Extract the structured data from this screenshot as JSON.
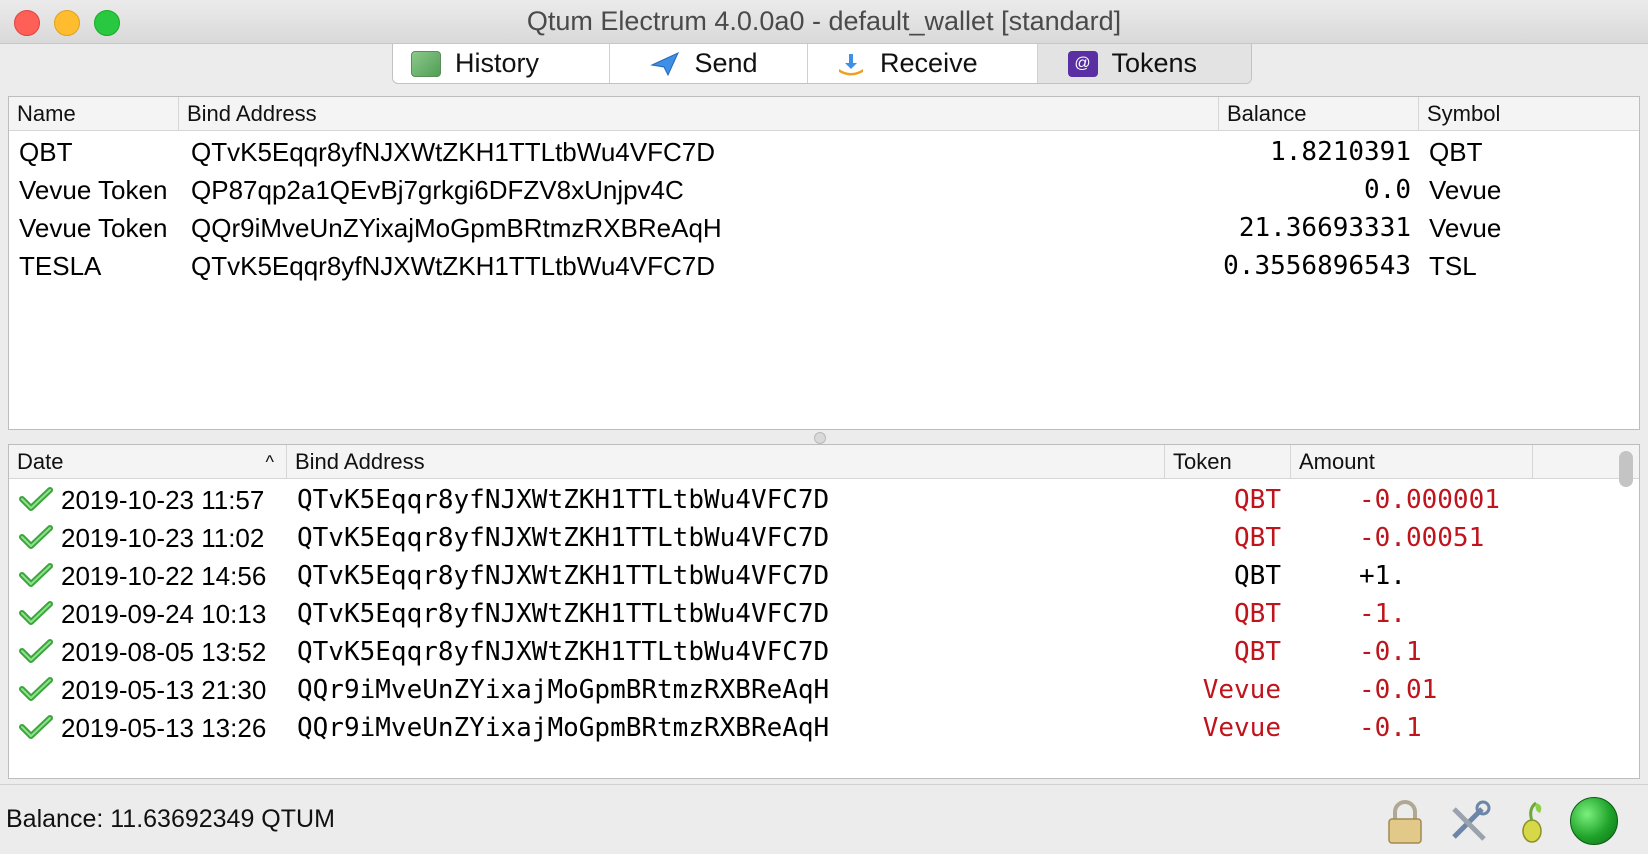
{
  "window": {
    "title": "Qtum Electrum 4.0.0a0  -  default_wallet  [standard]"
  },
  "tabs": [
    {
      "label": "History",
      "icon": "history-icon"
    },
    {
      "label": "Send",
      "icon": "send-icon"
    },
    {
      "label": "Receive",
      "icon": "receive-icon"
    },
    {
      "label": "Tokens",
      "icon": "tokens-icon",
      "active": true
    }
  ],
  "tokens_table": {
    "headers": {
      "name": "Name",
      "bind_address": "Bind Address",
      "balance": "Balance",
      "symbol": "Symbol"
    },
    "rows": [
      {
        "name": "QBT",
        "bind_address": "QTvK5Eqqr8yfNJXWtZKH1TTLtbWu4VFC7D",
        "balance": "1.8210391",
        "symbol": "QBT"
      },
      {
        "name": "Vevue Token",
        "bind_address": "QP87qp2a1QEvBj7grkgi6DFZV8xUnjpv4C",
        "balance": "0.0",
        "symbol": "Vevue"
      },
      {
        "name": "Vevue Token",
        "bind_address": "QQr9iMveUnZYixajMoGpmBRtmzRXBReAqH",
        "balance": "21.36693331",
        "symbol": "Vevue"
      },
      {
        "name": "TESLA",
        "bind_address": "QTvK5Eqqr8yfNJXWtZKH1TTLtbWu4VFC7D",
        "balance": "0.3556896543",
        "symbol": "TSL"
      }
    ]
  },
  "history_table": {
    "headers": {
      "date": "Date",
      "bind_address": "Bind Address",
      "token": "Token",
      "amount": "Amount"
    },
    "sort_indicator": "^",
    "rows": [
      {
        "date": "2019-10-23 11:57",
        "bind_address": "QTvK5Eqqr8yfNJXWtZKH1TTLtbWu4VFC7D",
        "token": "QBT",
        "amount": "-0.000001",
        "negative": true
      },
      {
        "date": "2019-10-23 11:02",
        "bind_address": "QTvK5Eqqr8yfNJXWtZKH1TTLtbWu4VFC7D",
        "token": "QBT",
        "amount": "-0.00051",
        "negative": true
      },
      {
        "date": "2019-10-22 14:56",
        "bind_address": "QTvK5Eqqr8yfNJXWtZKH1TTLtbWu4VFC7D",
        "token": "QBT",
        "amount": "+1.",
        "negative": false
      },
      {
        "date": "2019-09-24 10:13",
        "bind_address": "QTvK5Eqqr8yfNJXWtZKH1TTLtbWu4VFC7D",
        "token": "QBT",
        "amount": "-1.",
        "negative": true
      },
      {
        "date": "2019-08-05 13:52",
        "bind_address": "QTvK5Eqqr8yfNJXWtZKH1TTLtbWu4VFC7D",
        "token": "QBT",
        "amount": "-0.1",
        "negative": true
      },
      {
        "date": "2019-05-13 21:30",
        "bind_address": "QQr9iMveUnZYixajMoGpmBRtmzRXBReAqH",
        "token": "Vevue",
        "amount": "-0.01",
        "negative": true
      },
      {
        "date": "2019-05-13 13:26",
        "bind_address": "QQr9iMveUnZYixajMoGpmBRtmzRXBReAqH",
        "token": "Vevue",
        "amount": "-0.1",
        "negative": true
      }
    ]
  },
  "status": {
    "balance": "Balance: 11.63692349 QTUM"
  },
  "colors": {
    "negative_amount": "#c0141c",
    "network_ok": "#1fa32a"
  }
}
